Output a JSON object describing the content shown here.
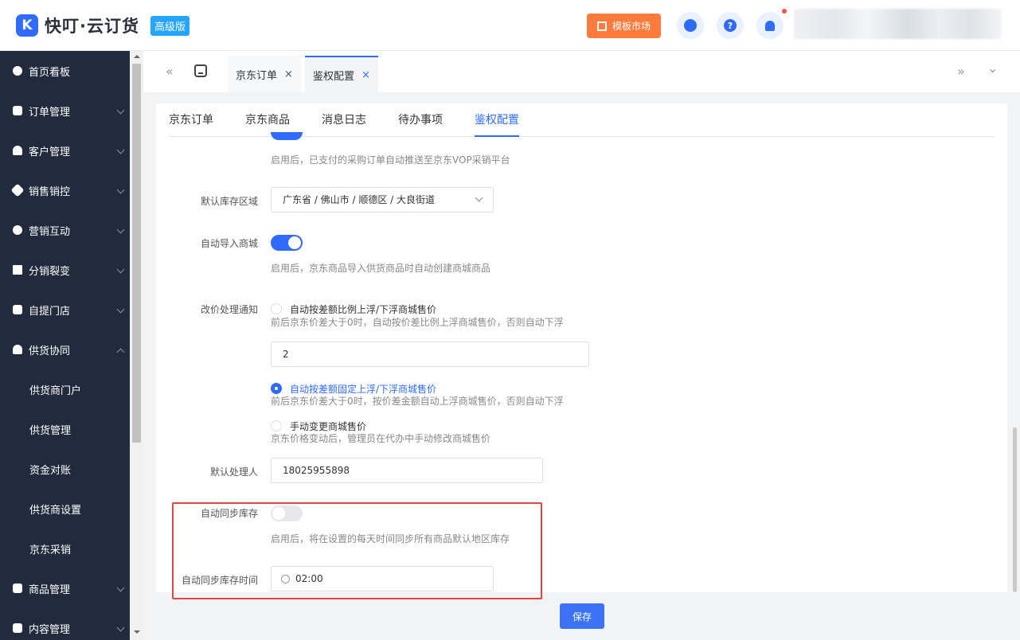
{
  "header": {
    "logo_mark": "K",
    "brand": "快叮·云订货",
    "edition": "高级版",
    "template_market": "模板市场",
    "help_glyph": "?"
  },
  "sidebar": {
    "items": [
      {
        "label": "首页看板"
      },
      {
        "label": "订单管理"
      },
      {
        "label": "客户管理"
      },
      {
        "label": "销售销控"
      },
      {
        "label": "营销互动"
      },
      {
        "label": "分销裂变"
      },
      {
        "label": "自提门店"
      },
      {
        "label": "供货协同"
      },
      {
        "label": "商品管理"
      },
      {
        "label": "内容管理"
      }
    ],
    "sub_items": [
      {
        "label": "供货商门户"
      },
      {
        "label": "供货管理"
      },
      {
        "label": "资金对账"
      },
      {
        "label": "供货商设置"
      },
      {
        "label": "京东采销"
      }
    ]
  },
  "tabbar": {
    "nav_left": "«",
    "nav_right": "»",
    "dropdown": "⌄",
    "tabs": [
      {
        "label": "京东订单",
        "close": "×"
      },
      {
        "label": "鉴权配置",
        "close": "×"
      }
    ]
  },
  "inner_tabs": [
    "京东订单",
    "京东商品",
    "消息日志",
    "待办事项",
    "鉴权配置"
  ],
  "form": {
    "auto_push_hint": "启用后，已支付的采购订单自动推送至京东VOP采销平台",
    "default_region_label": "默认库存区域",
    "default_region_value": "广东省 / 佛山市 / 顺德区 / 大良街道",
    "auto_import_label": "自动导入商城",
    "auto_import_hint": "启用后，京东商品导入供货商品时自动创建商城商品",
    "price_notice_label": "改价处理通知",
    "option1_label": "自动按差额比例上浮/下浮商城售价",
    "option1_hint": "前后京东价差大于0时，自动按价差比例上浮商城售价，否则自动下浮",
    "ratio_value": "2",
    "option2_label": "自动按差额固定上浮/下浮商城售价",
    "option2_hint": "前后京东价差大于0时，按价差金额自动上浮商城售价，否则自动下浮",
    "option3_label": "手动变更商城售价",
    "option3_hint": "京东价格变动后，管理员在代办中手动修改商城售价",
    "handler_label": "默认处理人",
    "handler_value": "18025955898",
    "sync_stock_label": "自动同步库存",
    "sync_stock_hint": "启用后，将在设置的每天时间同步所有商品默认地区库存",
    "sync_time_label": "自动同步库存时间",
    "sync_time_value": "02:00"
  },
  "save_label": "保存",
  "colors": {
    "accent": "#2f6bff",
    "sidebar": "#212b3d",
    "highlight": "#e5453d",
    "orange": "#ff7a3d"
  }
}
